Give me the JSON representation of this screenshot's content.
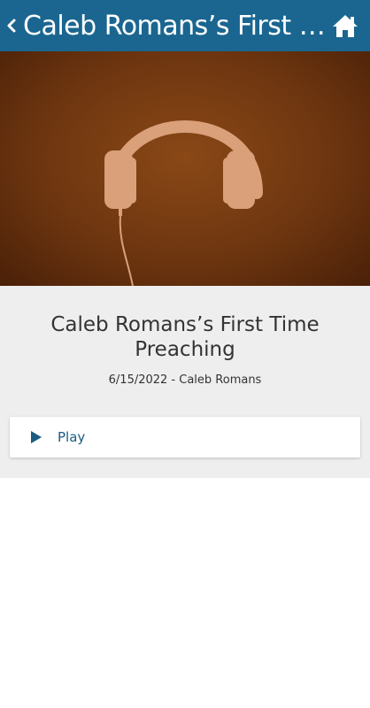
{
  "header": {
    "title": "Caleb Romans’s First Ti…",
    "background": "#1a6690"
  },
  "hero": {
    "image_icon": "headphones-icon"
  },
  "sermon": {
    "title": "Caleb Romans’s First Time Preaching",
    "meta": "6/15/2022 - Caleb Romans"
  },
  "media": {
    "play_label": "Play",
    "play_icon": "play-icon"
  }
}
